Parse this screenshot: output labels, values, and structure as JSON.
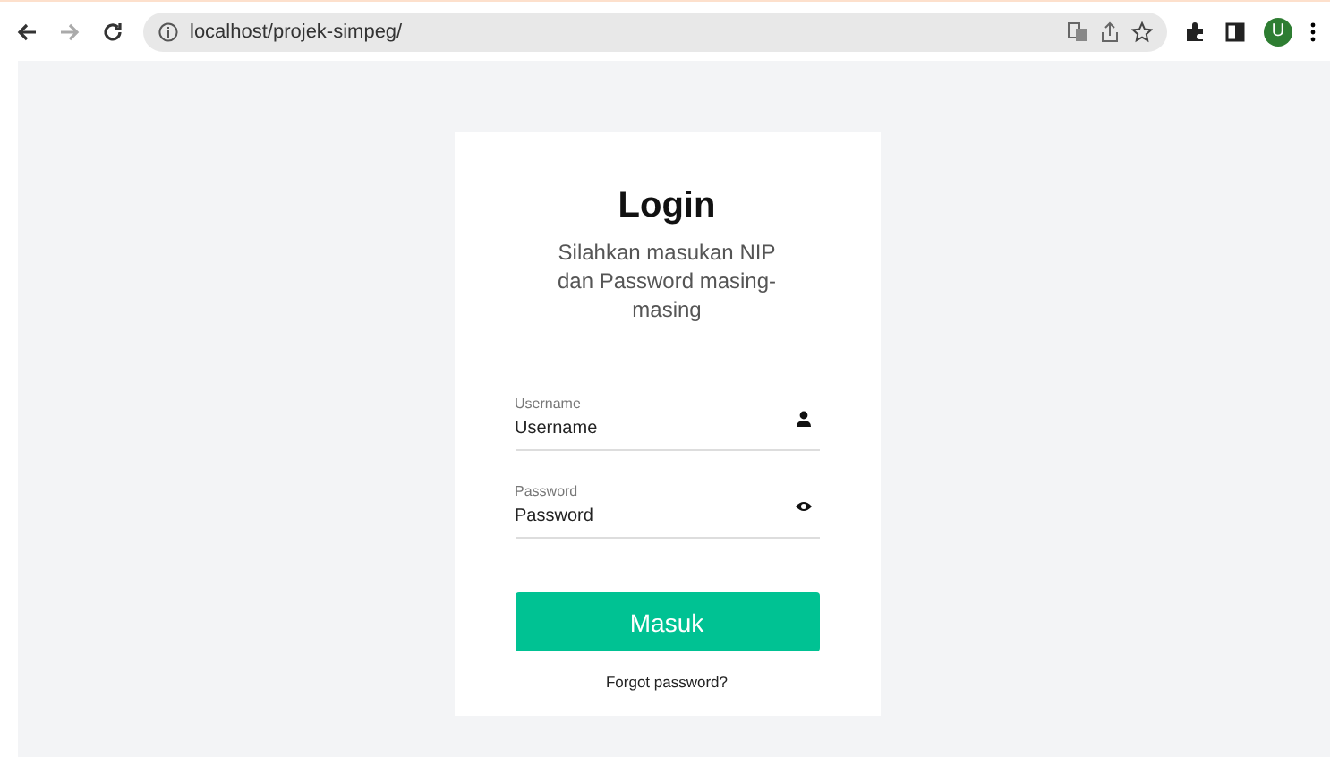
{
  "browser": {
    "url": "localhost/projek-simpeg/",
    "avatar": "U"
  },
  "login": {
    "title": "Login",
    "subtitle": "Silahkan masukan NIP dan Password masing-masing",
    "fields": [
      {
        "label": "Username",
        "value": "Username",
        "kind": "user"
      },
      {
        "label": "Password",
        "value": "Password",
        "kind": "password"
      }
    ],
    "submit": "Masuk",
    "forgot": "Forgot password?"
  }
}
